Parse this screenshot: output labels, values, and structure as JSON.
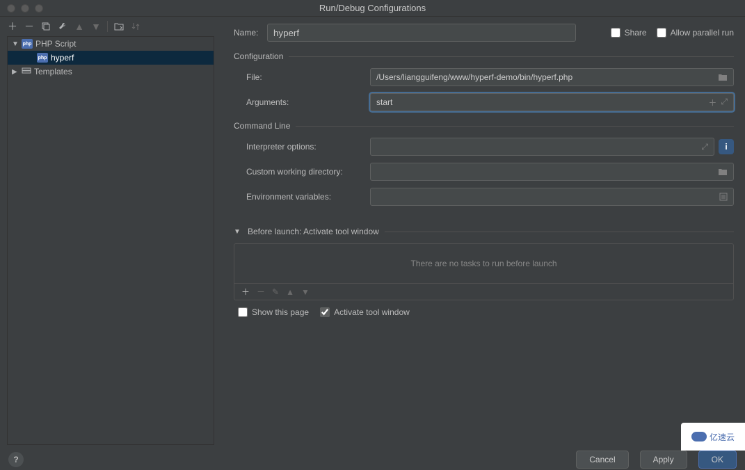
{
  "window": {
    "title": "Run/Debug Configurations"
  },
  "sidebar": {
    "items": [
      {
        "label": "PHP Script"
      },
      {
        "label": "hyperf"
      },
      {
        "label": "Templates"
      }
    ]
  },
  "form": {
    "name_label": "Name:",
    "name_value": "hyperf",
    "share_label": "Share",
    "parallel_label": "Allow parallel run"
  },
  "sections": {
    "configuration": {
      "title": "Configuration",
      "file_label": "File:",
      "file_value": "/Users/liangguifeng/www/hyperf-demo/bin/hyperf.php",
      "args_label": "Arguments:",
      "args_value": "start"
    },
    "commandline": {
      "title": "Command Line",
      "interpreter_label": "Interpreter options:",
      "interpreter_value": "",
      "cwd_label": "Custom working directory:",
      "cwd_value": "",
      "env_label": "Environment variables:",
      "env_value": ""
    },
    "before": {
      "title": "Before launch: Activate tool window",
      "empty_text": "There are no tasks to run before launch",
      "show_page": "Show this page",
      "activate": "Activate tool window"
    }
  },
  "footer": {
    "cancel": "Cancel",
    "apply": "Apply",
    "ok": "OK"
  },
  "watermark": "亿速云"
}
